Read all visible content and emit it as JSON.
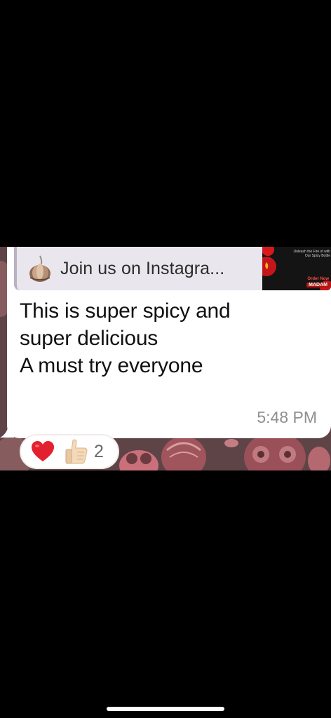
{
  "message": {
    "preview": {
      "icon": "garlic-icon",
      "title": "Join us on Instagra...",
      "thumbnail": {
        "tagline": "Unleash the Fire of with Our Spicy Bottle",
        "order": "Order Now",
        "brand": "MADAM"
      }
    },
    "lines": [
      "This is super spicy and",
      "super delicious",
      "A must try everyone"
    ],
    "time": "5:48 PM"
  },
  "reactions": {
    "emoji": [
      "heart-icon",
      "thumbs-up-icon"
    ],
    "count": "2"
  },
  "colors": {
    "bubble": "#ffffff",
    "wallpaper": "#6b4a4c",
    "preview_bg": "#e9e6ee",
    "time": "#8e8e93",
    "heart": "#e3202f"
  }
}
